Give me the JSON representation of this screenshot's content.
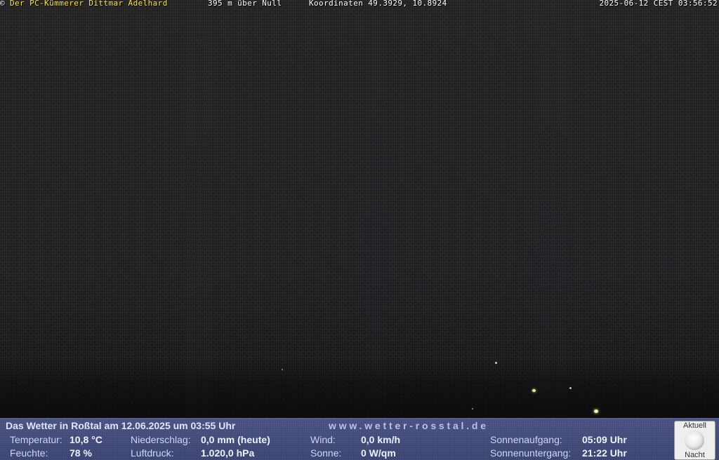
{
  "header": {
    "copyright_symbol": "©",
    "owner": "Der PC-Kümmerer Dittmar Adelhard",
    "altitude": "395 m über Null",
    "coordinates": "Koordinaten 49.3929, 10.8924",
    "timestamp": "2025-06-12 CEST 03:56:52"
  },
  "weather": {
    "title": "Das Wetter in Roßtal am 12.06.2025 um 03:55 Uhr",
    "site_url": "www.wetter-rosstal.de",
    "temperature_label": "Temperatur:",
    "temperature_value": "10,8 °C",
    "humidity_label": "Feuchte:",
    "humidity_value": "78 %",
    "precipitation_label": "Niederschlag:",
    "precipitation_value": "0,0 mm (heute)",
    "pressure_label": "Luftdruck:",
    "pressure_value": "1.020,0 hPa",
    "wind_label": "Wind:",
    "wind_value": "0,0 km/h",
    "sun_label": "Sonne:",
    "sun_value": "0 W/qm",
    "sunrise_label": "Sonnenaufgang:",
    "sunrise_value": "05:09 Uhr",
    "sunset_label": "Sonnenuntergang:",
    "sunset_value": "21:22 Uhr"
  },
  "moon": {
    "label_top": "Aktuell",
    "icon": "moon-full-icon",
    "label_bottom": "Nacht"
  },
  "colors": {
    "owner_text": "#ffe640",
    "weather_bar_bg": "#3e4775"
  }
}
